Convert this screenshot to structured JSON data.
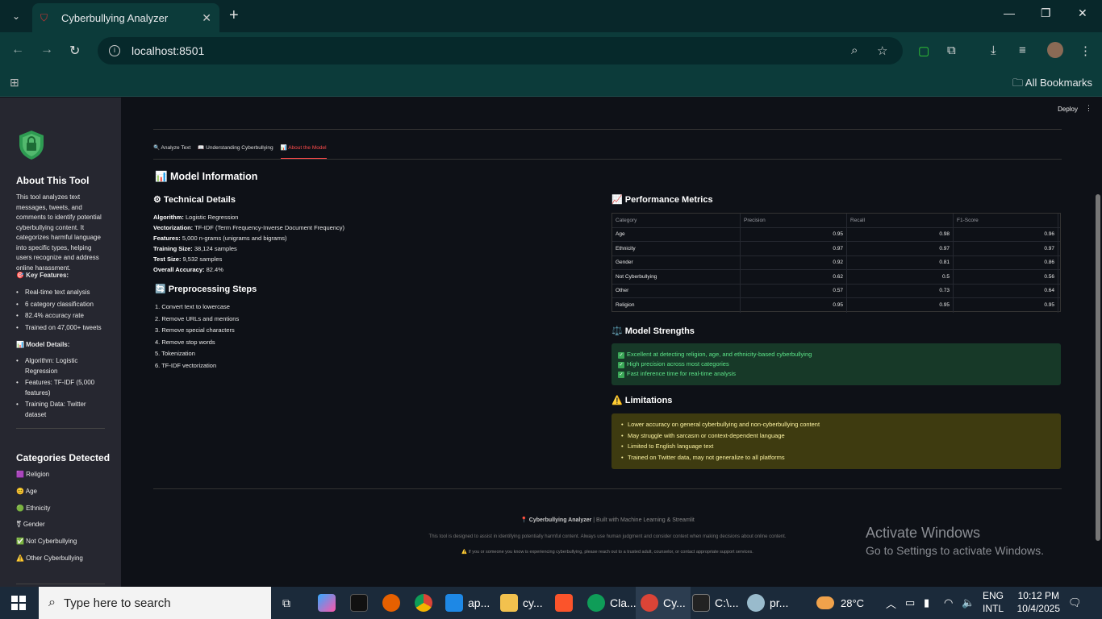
{
  "browser": {
    "tab_title": "Cyberbullying Analyzer",
    "url": "localhost:8501",
    "bookmarks_label": "All Bookmarks"
  },
  "sidebar": {
    "about_title": "About This Tool",
    "about_text": "This tool analyzes text messages, tweets, and comments to identify potential cyberbullying content. It categorizes harmful language into specific types, helping users recognize and address online harassment.",
    "key_features_title": "🎯 Key Features:",
    "key_features": [
      "Real-time text analysis",
      "6 category classification",
      "82.4% accuracy rate",
      "Trained on 47,000+ tweets"
    ],
    "model_details_title": "📊 Model Details:",
    "model_details": [
      "Algorithm: Logistic Regression",
      "Features: TF-IDF (5,000 features)",
      "Training Data: Twitter dataset"
    ],
    "categories_title": "Categories Detected",
    "categories": [
      "🟪 Religion",
      "😊 Age",
      "🟢 Ethnicity",
      "⚧ Gender",
      "✅ Not Cyberbullying",
      "⚠️ Other Cyberbullying"
    ]
  },
  "app": {
    "deploy_label": "Deploy",
    "tabs": [
      "🔍 Analyze Text",
      "📖 Understanding Cyberbullying",
      "📊 About the Model"
    ],
    "section_title": "📊 Model Information",
    "tech_title": "⚙ Technical Details",
    "tech_details": [
      {
        "k": "Algorithm:",
        "v": " Logistic Regression"
      },
      {
        "k": "Vectorization:",
        "v": " TF-IDF (Term Frequency-Inverse Document Frequency)"
      },
      {
        "k": "Features:",
        "v": " 5,000 n-grams (unigrams and bigrams)"
      },
      {
        "k": "Training Size:",
        "v": " 38,124 samples"
      },
      {
        "k": "Test Size:",
        "v": " 9,532 samples"
      },
      {
        "k": "Overall Accuracy:",
        "v": " 82.4%"
      }
    ],
    "prep_title": "🔄 Preprocessing Steps",
    "prep_steps": [
      "1.  Convert text to lowercase",
      "2.  Remove URLs and mentions",
      "3.  Remove special characters",
      "4.  Remove stop words",
      "5.  Tokenization",
      "6.  TF-IDF vectorization"
    ],
    "perf_title": "📈 Performance Metrics",
    "table": {
      "headers": [
        "Category",
        "Precision",
        "Recall",
        "F1-Score"
      ],
      "rows": [
        [
          "Age",
          "0.95",
          "0.98",
          "0.96"
        ],
        [
          "Ethnicity",
          "0.97",
          "0.97",
          "0.97"
        ],
        [
          "Gender",
          "0.92",
          "0.81",
          "0.86"
        ],
        [
          "Not Cyberbullying",
          "0.62",
          "0.5",
          "0.56"
        ],
        [
          "Other",
          "0.57",
          "0.73",
          "0.64"
        ],
        [
          "Religion",
          "0.95",
          "0.95",
          "0.95"
        ]
      ]
    },
    "strengths_title": "⚖️ Model Strengths",
    "strengths": [
      "Excellent at detecting religion, age, and ethnicity-based cyberbullying",
      "High precision across most categories",
      "Fast inference time for real-time analysis"
    ],
    "limits_title": "⚠️ Limitations",
    "limits": [
      "Lower accuracy on general cyberbullying and non-cyberbullying content",
      "May struggle with sarcasm or context-dependent language",
      "Limited to English language text",
      "Trained on Twitter data, may not generalize to all platforms"
    ],
    "footer_brand": "📍 Cyberbullying Analyzer",
    "footer_brand_rest": " | Built with Machine Learning & Streamlit",
    "footer_note": "This tool is designed to assist in identifying potentially harmful content. Always use human judgment and consider context when making decisions about online content.",
    "footer_help": "⚠️ If you or someone you know is experiencing cyberbullying, please reach out to a trusted adult, counselor, or contact appropriate support services."
  },
  "watermark": {
    "line1": "Activate Windows",
    "line2": "Go to Settings to activate Windows."
  },
  "taskbar": {
    "search_placeholder": "Type here to search",
    "apps": [
      "ap...",
      "cy...",
      "Cla...",
      "Cy...",
      "C:\\...",
      "pr..."
    ],
    "weather": "28°C",
    "lang1": "ENG",
    "lang2": "INTL",
    "time": "10:12 PM",
    "date": "10/4/2025"
  },
  "colors": {
    "accent": "#ff4b4b",
    "sidebar_bg": "#262730",
    "main_bg": "#0e1117",
    "success": "#173928",
    "warning": "#3e3b10"
  }
}
